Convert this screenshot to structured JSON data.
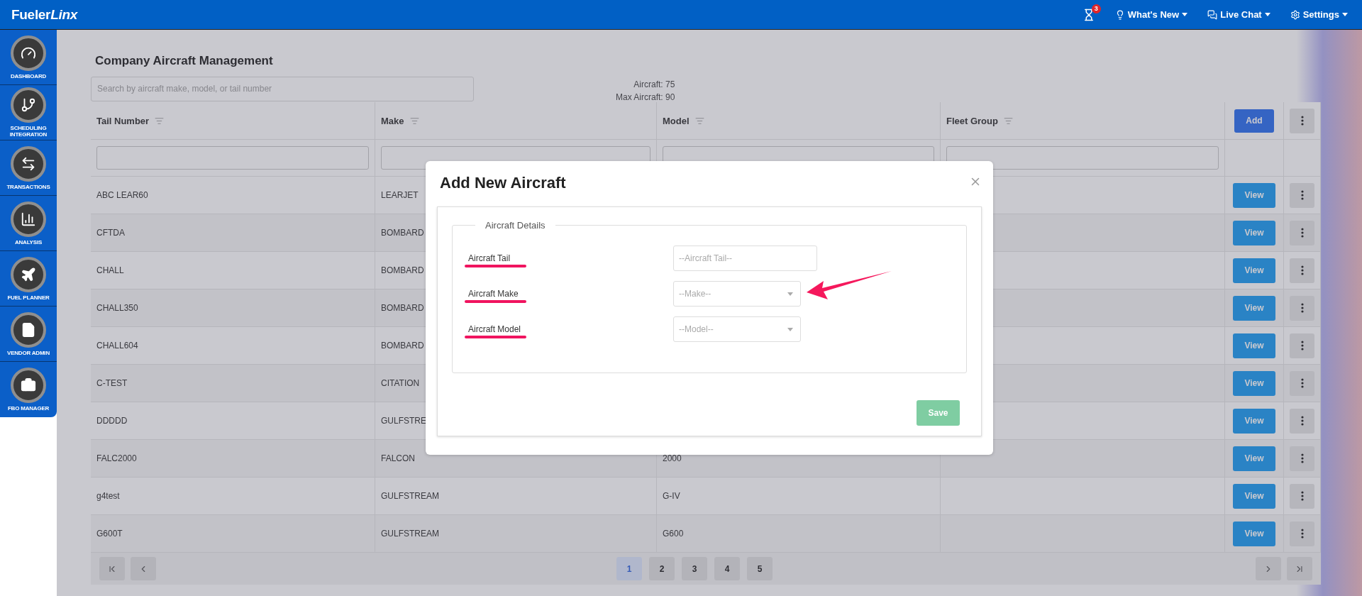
{
  "navbar": {
    "brand": [
      "Fueler",
      "Linx"
    ],
    "notification_count": "3",
    "menus": [
      {
        "label": "What's New",
        "kind": "whatsnew"
      },
      {
        "label": "Live Chat",
        "kind": "chat"
      },
      {
        "label": "Settings",
        "kind": "settings"
      }
    ]
  },
  "sidebar": {
    "items": [
      {
        "label": "DASHBOARD",
        "kind": "dashboard"
      },
      {
        "label": "SCHEDULING INTEGRATION",
        "kind": "scheduling"
      },
      {
        "label": "TRANSACTIONS",
        "kind": "transactions"
      },
      {
        "label": "ANALYSIS",
        "kind": "analysis"
      },
      {
        "label": "FUEL PLANNER",
        "kind": "planner"
      },
      {
        "label": "VENDOR ADMIN",
        "kind": "vendor"
      },
      {
        "label": "FBO MANAGER",
        "kind": "fbo"
      }
    ]
  },
  "page": {
    "title": "Company Aircraft Management",
    "search": {
      "placeholder": "Search by aircraft make, model, or tail number"
    },
    "counts": [
      "Aircraft: 75",
      "Max Aircraft: 90"
    ]
  },
  "table": {
    "columns": [
      "Tail Number",
      "Make",
      "Model",
      "Fleet Group"
    ],
    "add_button": "Add",
    "rows": [
      {
        "tail_number": "ABC LEAR60",
        "make": "LEARJET",
        "view_button": "View"
      },
      {
        "tail_number": "CFTDA",
        "make": "BOMBARD",
        "view_button": "View"
      },
      {
        "tail_number": "CHALL",
        "make": "BOMBARD",
        "view_button": "View"
      },
      {
        "tail_number": "CHALL350",
        "make": "BOMBARD",
        "view_button": "View"
      },
      {
        "tail_number": "CHALL604",
        "make": "BOMBARD",
        "view_button": "View"
      },
      {
        "tail_number": "C-TEST",
        "make": "CITATION",
        "view_button": "View"
      },
      {
        "tail_number": "DDDDD",
        "make": "GULFSTRE",
        "view_button": "View"
      },
      {
        "tail_number": "FALC2000",
        "make": "FALCON",
        "model": "2000",
        "view_button": "View"
      },
      {
        "tail_number": "g4test",
        "make": "GULFSTREAM",
        "model": "G-IV",
        "view_button": "View"
      },
      {
        "tail_number": "G600T",
        "make": "GULFSTREAM",
        "model": "G600",
        "view_button": "View"
      }
    ]
  },
  "pagination": {
    "pages": [
      {
        "label": "1",
        "selected": true
      },
      {
        "label": "2",
        "selected": false
      },
      {
        "label": "3",
        "selected": false
      },
      {
        "label": "4",
        "selected": false
      },
      {
        "label": "5",
        "selected": false
      }
    ]
  },
  "modal": {
    "title": "Add New Aircraft",
    "section": "Aircraft Details",
    "fields": [
      {
        "label": "Aircraft Tail",
        "kind": "text",
        "placeholder": "--Aircraft Tail--"
      },
      {
        "label": "Aircraft Make",
        "kind": "select",
        "placeholder": "--Make--"
      },
      {
        "label": "Aircraft Model",
        "kind": "select",
        "placeholder": "--Model--"
      }
    ],
    "save_button": {
      "label": "Save",
      "disabled": true
    }
  }
}
